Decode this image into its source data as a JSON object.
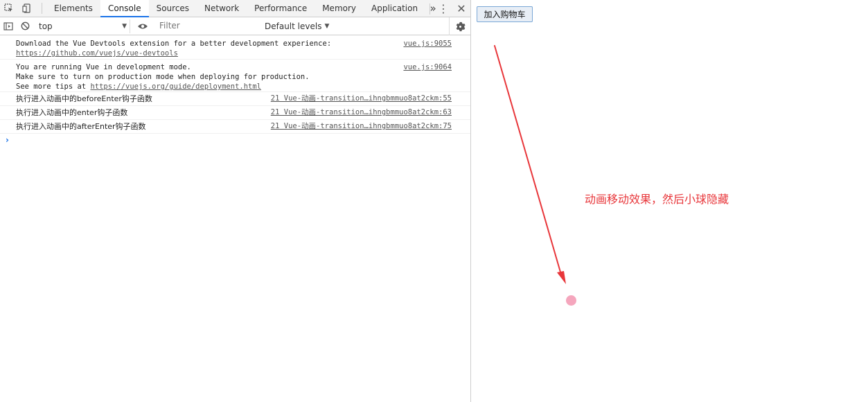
{
  "devtools": {
    "tabs": [
      {
        "label": "Elements"
      },
      {
        "label": "Console"
      },
      {
        "label": "Sources"
      },
      {
        "label": "Network"
      },
      {
        "label": "Performance"
      },
      {
        "label": "Memory"
      },
      {
        "label": "Application"
      }
    ],
    "active_tab": "Console",
    "more_tabs_glyph": "»",
    "toolbar": {
      "context": "top",
      "filter_placeholder": "Filter",
      "levels": "Default levels"
    }
  },
  "console": {
    "messages": [
      {
        "lines": [
          "Download the Vue Devtools extension for a better development experience:"
        ],
        "link": "https://github.com/vuejs/vue-devtools",
        "source": "vue.js:9055"
      },
      {
        "lines": [
          "You are running Vue in development mode.",
          "Make sure to turn on production mode when deploying for production."
        ],
        "link_prefix": "See more tips at ",
        "link": "https://vuejs.org/guide/deployment.html",
        "source": "vue.js:9064"
      }
    ],
    "logs": [
      {
        "text": "执行进入动画中的beforeEnter钩子函数",
        "source": "21 Vue-动画-transition…ihngbmmuo8at2ckm:55"
      },
      {
        "text": "执行进入动画中的enter钩子函数",
        "source": "21 Vue-动画-transition…ihngbmmuo8at2ckm:63"
      },
      {
        "text": "执行进入动画中的afterEnter钩子函数",
        "source": "21 Vue-动画-transition…ihngbmmuo8at2ckm:75"
      }
    ],
    "prompt_glyph": "›"
  },
  "page": {
    "cart_button": "加入购物车",
    "annotation": "动画移动效果，然后小球隐藏",
    "annotation_color": "#e8363a",
    "ball_color": "#f5a6bd"
  }
}
